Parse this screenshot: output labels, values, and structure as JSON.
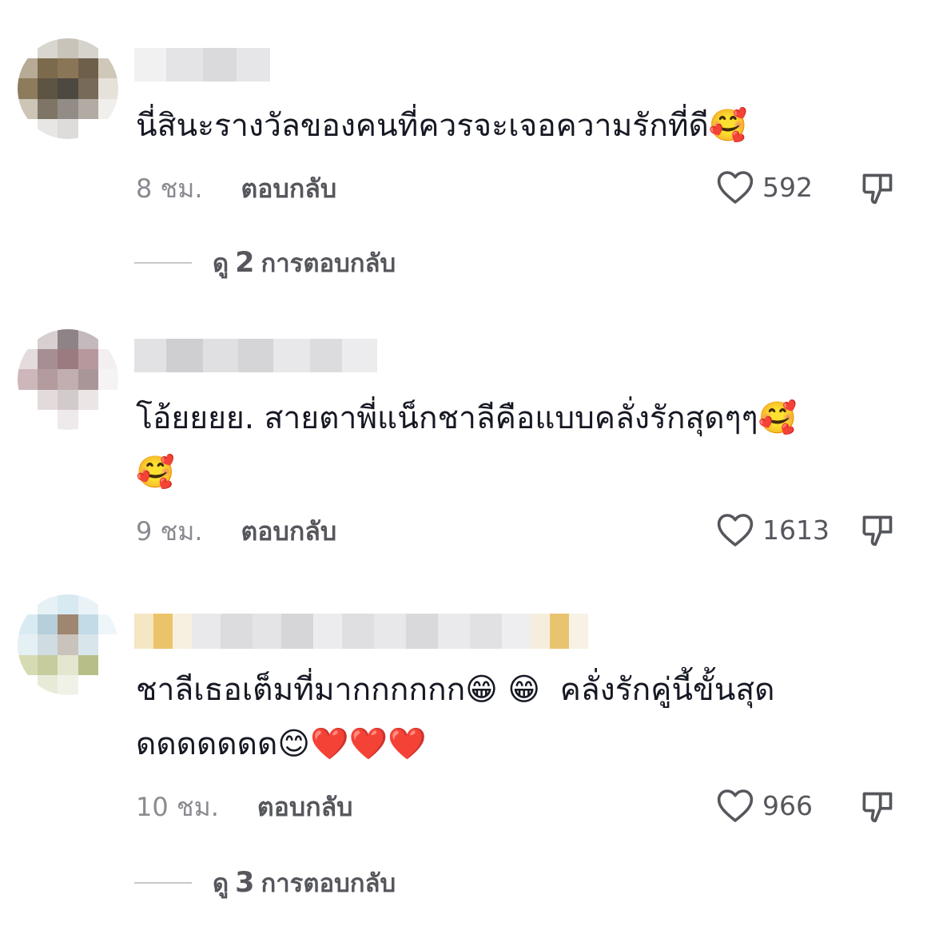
{
  "comments": [
    {
      "text": "นี่สินะรางวัลของคนที่ควรจะเจอความรักที่ดี🥰",
      "time": "8 ชม.",
      "reply_label": "ตอบกลับ",
      "likes": "592",
      "view_replies": {
        "prefix": "ดู",
        "count": "2",
        "suffix": "การตอบกลับ"
      }
    },
    {
      "text": "โอ้ยยยย. สายตาพี่แน็กชาลีคือแบบคลั่งรักสุดๆๆ🥰\n🥰",
      "time": "9 ชม.",
      "reply_label": "ตอบกลับ",
      "likes": "1613"
    },
    {
      "text": "ชาลีเธอเต็มที่มากกกกกก😁 😁  คลั่งรักคู่นี้ขั้นสุด\nดดดดดดด😊❤️❤️❤️",
      "time": "10 ชม.",
      "reply_label": "ตอบกลับ",
      "likes": "966",
      "view_replies": {
        "prefix": "ดู",
        "count": "3",
        "suffix": "การตอบกลับ"
      }
    }
  ],
  "icons": {
    "like": "heart-outline-icon",
    "dislike": "thumbs-down-icon"
  },
  "colors": {
    "text": "#161823",
    "secondary": "#8a8b91",
    "action": "#56575d"
  }
}
